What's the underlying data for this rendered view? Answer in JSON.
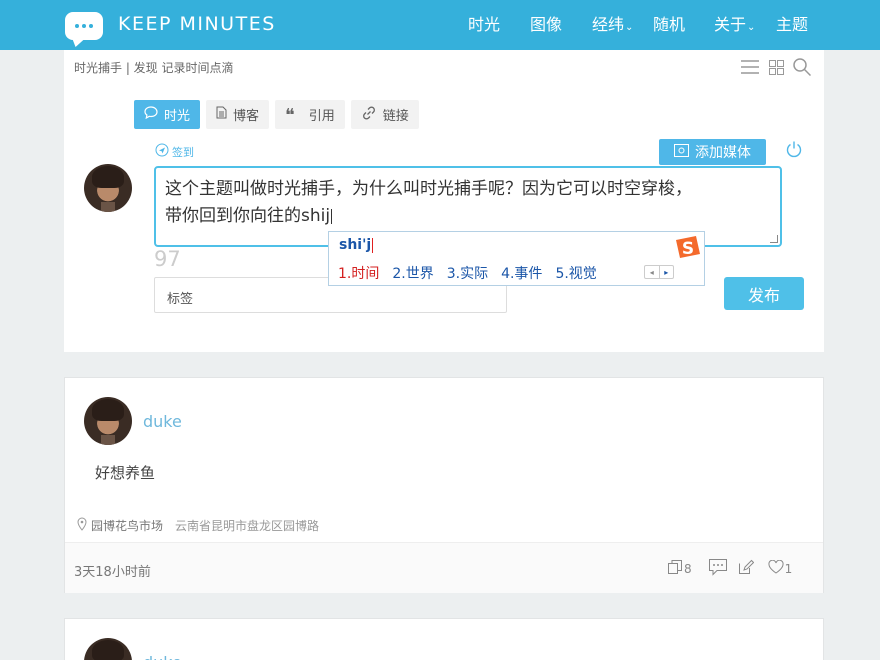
{
  "header": {
    "brand": "KEEP MINUTES",
    "nav": [
      {
        "label": "时光",
        "caret": ""
      },
      {
        "label": "图像",
        "caret": ""
      },
      {
        "label": "经纬",
        "caret": "⌄"
      },
      {
        "label": "随机",
        "caret": ""
      },
      {
        "label": "关于",
        "caret": "⌄"
      },
      {
        "label": "主题",
        "caret": ""
      }
    ]
  },
  "editor": {
    "breadcrumb": "时光捕手 | 发现 记录时间点滴",
    "tabs": [
      {
        "label": "时光",
        "icon": "comment-icon"
      },
      {
        "label": "博客",
        "icon": "document-icon"
      },
      {
        "label": "引用",
        "icon": "quote-icon"
      },
      {
        "label": "链接",
        "icon": "link-icon"
      }
    ],
    "checkin_label": "签到",
    "media_button": "添加媒体",
    "text_line1": "这个主题叫做时光捕手，为什么叫时光捕手呢？因为它可以时空穿梭，",
    "text_line2": "带你回到你向往的shij",
    "char_counter": "97",
    "tags_placeholder": "标签",
    "publish_button": "发布",
    "accent_color": "#4fb7e8"
  },
  "ime": {
    "composition": "shi'j",
    "candidates": [
      "1.时间",
      "2.世界",
      "3.实际",
      "4.事件",
      "5.视觉"
    ],
    "prev": "◂",
    "next": "▸"
  },
  "posts": [
    {
      "user": "duke",
      "body": "好想养鱼",
      "location_name": "园博花鸟市场",
      "location_address": "云南省昆明市盘龙区园博路",
      "time": "3天18小时前",
      "copies": "8",
      "likes": "1"
    },
    {
      "user": "duke"
    }
  ]
}
